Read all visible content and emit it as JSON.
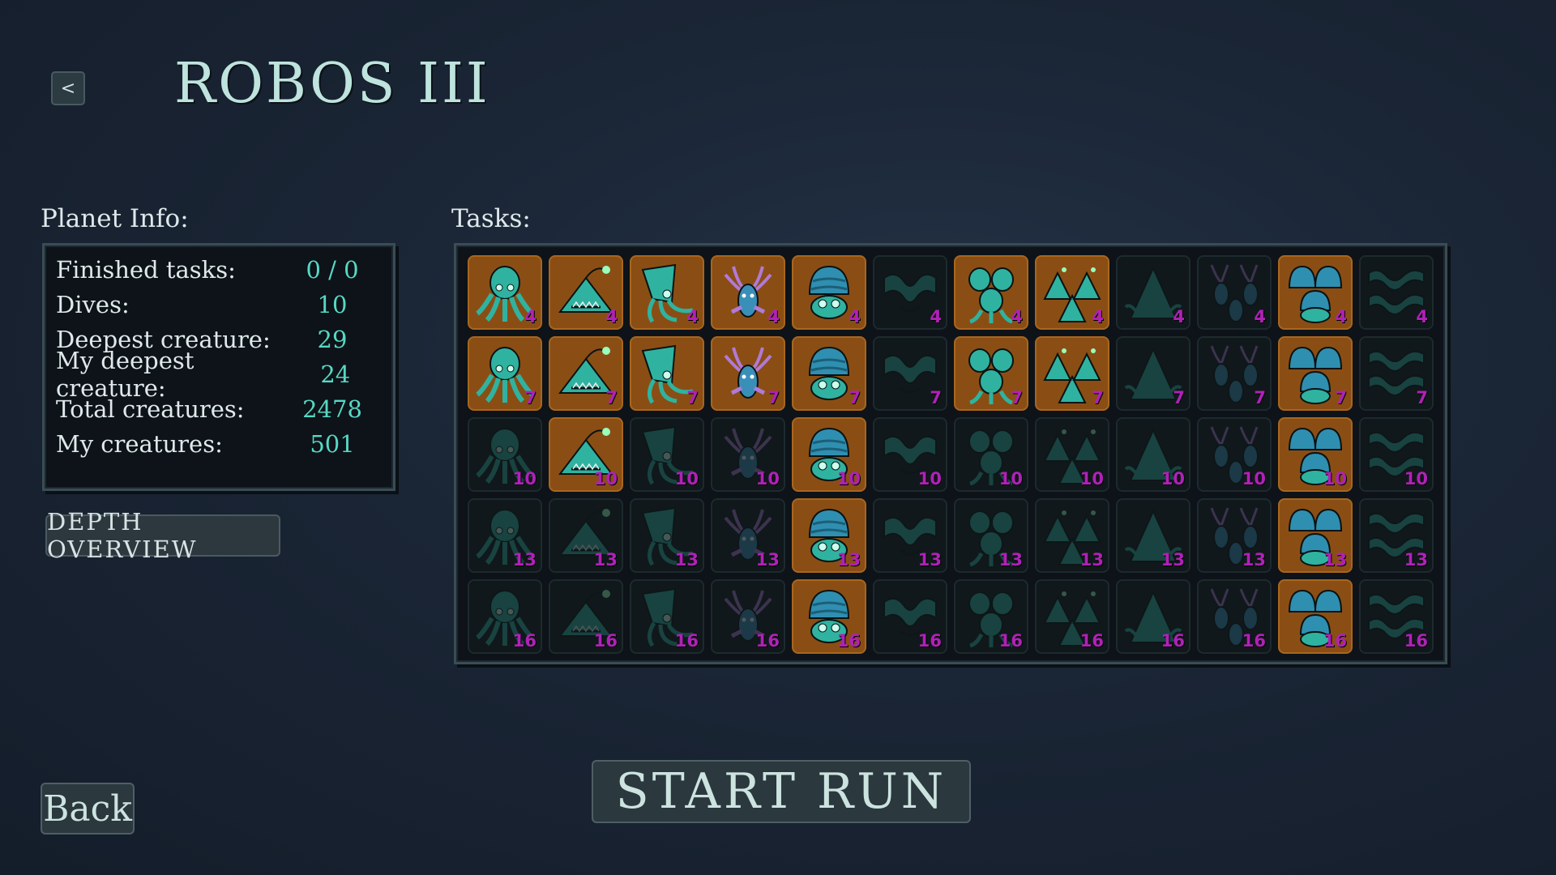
{
  "header": {
    "nav_arrow": "<",
    "planet_name": "ROBOS III"
  },
  "planet_info": {
    "label": "Planet Info:",
    "rows": [
      {
        "key": "Finished tasks:",
        "value": "0 / 0"
      },
      {
        "key": "Dives:",
        "value": "10"
      },
      {
        "key": "Deepest creature:",
        "value": "29"
      },
      {
        "key": "My deepest creature:",
        "value": "24"
      },
      {
        "key": "Total creatures:",
        "value": "2478"
      },
      {
        "key": "My creatures:",
        "value": "501"
      }
    ],
    "depth_button": "DEPTH OVERVIEW"
  },
  "tasks": {
    "label": "Tasks:",
    "creatures": [
      "octopus-icon",
      "anglerfish-icon",
      "squid-icon",
      "axolotl-icon",
      "hermit-crab-icon",
      "eel-icon",
      "octopus-pair-icon",
      "anglerfish-school-icon",
      "kraken-icon",
      "axolotl-swarm-icon",
      "hermit-crab-group-icon",
      "eel-swarm-icon"
    ],
    "rows": [
      {
        "depth": "4",
        "done": [
          true,
          true,
          true,
          true,
          true,
          false,
          true,
          true,
          false,
          false,
          true,
          false
        ]
      },
      {
        "depth": "7",
        "done": [
          true,
          true,
          true,
          true,
          true,
          false,
          true,
          true,
          false,
          false,
          true,
          false
        ]
      },
      {
        "depth": "10",
        "done": [
          false,
          true,
          false,
          false,
          true,
          false,
          false,
          false,
          false,
          false,
          true,
          false
        ]
      },
      {
        "depth": "13",
        "done": [
          false,
          false,
          false,
          false,
          true,
          false,
          false,
          false,
          false,
          false,
          true,
          false
        ]
      },
      {
        "depth": "16",
        "done": [
          false,
          false,
          false,
          false,
          true,
          false,
          false,
          false,
          false,
          false,
          true,
          false
        ]
      }
    ]
  },
  "footer": {
    "start_run": "START RUN",
    "back": "Back"
  },
  "colors": {
    "done_tile": "#8a4e14",
    "creature_teal": "#2fb3a0",
    "creature_blue": "#2f8fb0",
    "depth_number": "#b021b8",
    "stat_value": "#57d8c5"
  }
}
